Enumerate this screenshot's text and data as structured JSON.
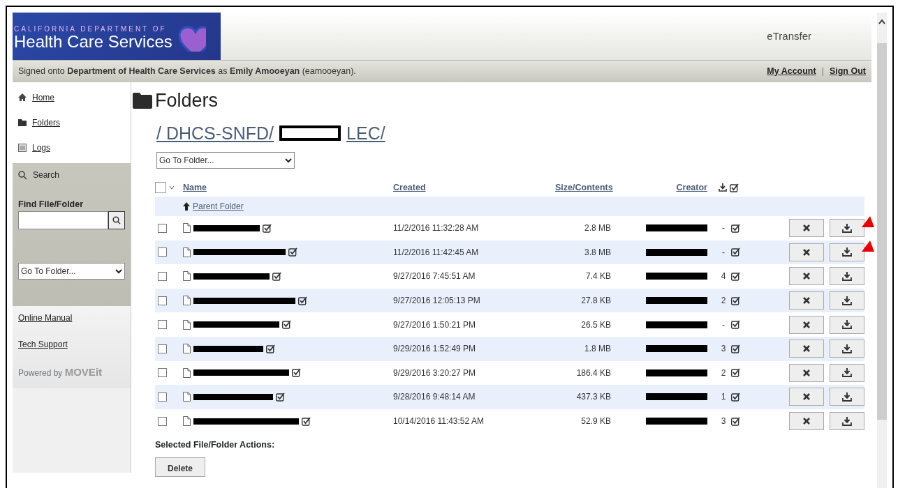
{
  "window": {
    "brand_small": "CALIFORNIA DEPARTMENT OF",
    "brand": "Health Care Services",
    "app_name": "eTransfer"
  },
  "user_bar": {
    "text": "Signed onto **Department of Health Care Services** as **Emily Amooeyan** (eamooeyan).",
    "links": [
      "My Account",
      "Sign Out"
    ],
    "separator": "|"
  },
  "sidebar": {
    "nav": [
      {
        "label": "Home"
      },
      {
        "label": "Folders"
      },
      {
        "label": "Logs"
      }
    ],
    "search_label": "Search",
    "find_label": "Find File/Folder",
    "goto": "Go To Folder...",
    "links": [
      "Online Manual",
      "Tech Support"
    ],
    "powered_by": "Powered by",
    "powered_brand": "MOVEit"
  },
  "content": {
    "title": "Folders",
    "path": [
      {
        "kind": "text",
        "text": "/ DHCS-SNFD/"
      },
      {
        "kind": "redacted"
      },
      {
        "kind": "text",
        "text": "LEC/"
      }
    ],
    "goto": "Go To Folder...",
    "table": {
      "all_selected": false,
      "columns": [
        "Name",
        "Created",
        "Size/Contents",
        "Creator"
      ],
      "parent": "Parent Folder",
      "rows": [
        {
          "selected": false,
          "created": "11/2/2016 11:32:28 AM",
          "size": "2.8 MB",
          "downloads": "-",
          "annotated": true
        },
        {
          "selected": false,
          "created": "11/2/2016 11:42:45 AM",
          "size": "3.8 MB",
          "downloads": "-",
          "annotated": true
        },
        {
          "selected": false,
          "created": "9/27/2016 7:45:51 AM",
          "size": "7.4 KB",
          "downloads": "4",
          "annotated": false
        },
        {
          "selected": false,
          "created": "9/27/2016 12:05:13 PM",
          "size": "27.8 KB",
          "downloads": "2",
          "annotated": false
        },
        {
          "selected": false,
          "created": "9/27/2016 1:50:21 PM",
          "size": "26.5 KB",
          "downloads": "-",
          "annotated": false
        },
        {
          "selected": false,
          "created": "9/29/2016 1:52:49 PM",
          "size": "1.8 MB",
          "downloads": "3",
          "annotated": false
        },
        {
          "selected": false,
          "created": "9/29/2016 3:20:27 PM",
          "size": "186.4 KB",
          "downloads": "2",
          "annotated": false
        },
        {
          "selected": false,
          "created": "9/28/2016 9:48:14 AM",
          "size": "437.3 KB",
          "downloads": "1",
          "annotated": false
        },
        {
          "selected": false,
          "created": "10/14/2016 11:43:52 AM",
          "size": "52.9 KB",
          "downloads": "3",
          "annotated": false
        }
      ],
      "actions_label": "Selected File/Folder Actions:",
      "delete": "Delete"
    }
  }
}
